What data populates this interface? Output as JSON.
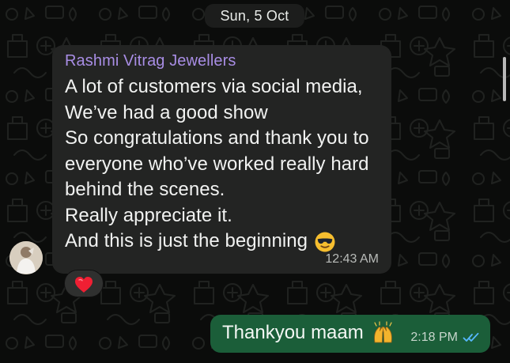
{
  "date_separator": {
    "label": "Sun, 5 Oct"
  },
  "incoming_message": {
    "sender": "Rashmi Vitrag Jewellers",
    "lines": [
      "A lot of customers via social media,",
      "We’ve had a good show",
      "So congratulations and thank you to",
      "everyone who’ve worked really hard",
      "behind the scenes.",
      "Really appreciate it.",
      "And this is just the beginning"
    ],
    "emoji": "sunglasses-face-icon",
    "time": "12:43 AM",
    "reaction": "red-heart-icon"
  },
  "outgoing_message": {
    "text": "Thankyou maam",
    "emoji": "raised-hands-icon",
    "time": "2:18 PM",
    "status": "read-double-check-icon"
  },
  "colors": {
    "background": "#0b0c0b",
    "incoming_bubble": "#232423",
    "outgoing_bubble": "#1b5e39",
    "sender_name": "#a88de4",
    "read_check": "#56b8ff"
  }
}
